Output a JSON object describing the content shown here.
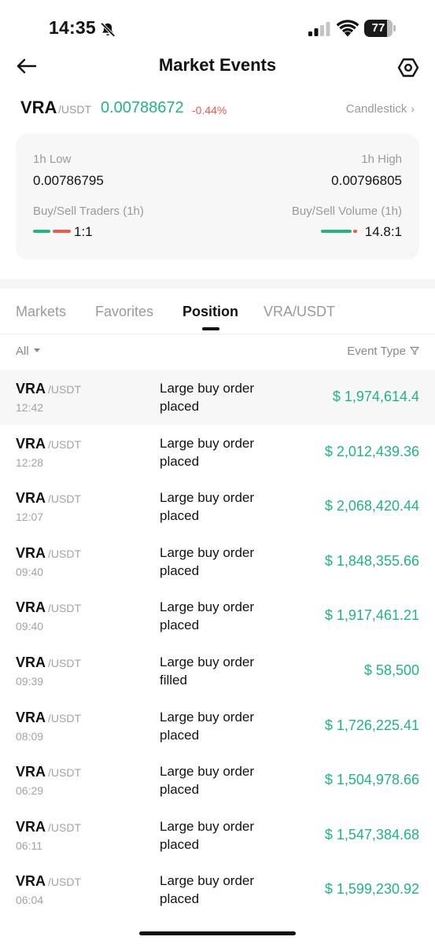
{
  "status_bar": {
    "time": "14:35",
    "battery": "77"
  },
  "header": {
    "title": "Market Events"
  },
  "pair": {
    "base": "VRA",
    "quote": "/USDT",
    "price": "0.00788672",
    "change": "-0.44%",
    "candlestick_label": "Candlestick",
    "candlestick_chevron": "›"
  },
  "stats": {
    "low_label": "1h Low",
    "low_value": "0.00786795",
    "high_label": "1h High",
    "high_value": "0.00796805",
    "traders_label": "Buy/Sell Traders (1h)",
    "traders_value": "1:1",
    "volume_label": "Buy/Sell Volume (1h)",
    "volume_value": "14.8:1",
    "colors": {
      "buy": "#20b486",
      "sell": "#ef5a44"
    }
  },
  "tabs": [
    {
      "label": "Markets",
      "active": false
    },
    {
      "label": "Favorites",
      "active": false
    },
    {
      "label": "Position",
      "active": true
    },
    {
      "label": "VRA/USDT",
      "active": false
    }
  ],
  "filters": {
    "all_label": "All",
    "event_type_label": "Event Type"
  },
  "events": [
    {
      "base": "VRA",
      "quote": "/USDT",
      "time": "12:42",
      "line1": "Large buy order",
      "line2": "placed",
      "amount": "$ 1,974,614.4"
    },
    {
      "base": "VRA",
      "quote": "/USDT",
      "time": "12:28",
      "line1": "Large buy order",
      "line2": "placed",
      "amount": "$ 2,012,439.36"
    },
    {
      "base": "VRA",
      "quote": "/USDT",
      "time": "12:07",
      "line1": "Large buy order",
      "line2": "placed",
      "amount": "$ 2,068,420.44"
    },
    {
      "base": "VRA",
      "quote": "/USDT",
      "time": "09:40",
      "line1": "Large buy order",
      "line2": "placed",
      "amount": "$ 1,848,355.66"
    },
    {
      "base": "VRA",
      "quote": "/USDT",
      "time": "09:40",
      "line1": "Large buy order",
      "line2": "placed",
      "amount": "$ 1,917,461.21"
    },
    {
      "base": "VRA",
      "quote": "/USDT",
      "time": "09:39",
      "line1": "Large buy order",
      "line2": "filled",
      "amount": "$ 58,500"
    },
    {
      "base": "VRA",
      "quote": "/USDT",
      "time": "08:09",
      "line1": "Large buy order",
      "line2": "placed",
      "amount": "$ 1,726,225.41"
    },
    {
      "base": "VRA",
      "quote": "/USDT",
      "time": "06:29",
      "line1": "Large buy order",
      "line2": "placed",
      "amount": "$ 1,504,978.66"
    },
    {
      "base": "VRA",
      "quote": "/USDT",
      "time": "06:11",
      "line1": "Large buy order",
      "line2": "placed",
      "amount": "$ 1,547,384.68"
    },
    {
      "base": "VRA",
      "quote": "/USDT",
      "time": "06:04",
      "line1": "Large buy order",
      "line2": "placed",
      "amount": "$ 1,599,230.92"
    }
  ]
}
